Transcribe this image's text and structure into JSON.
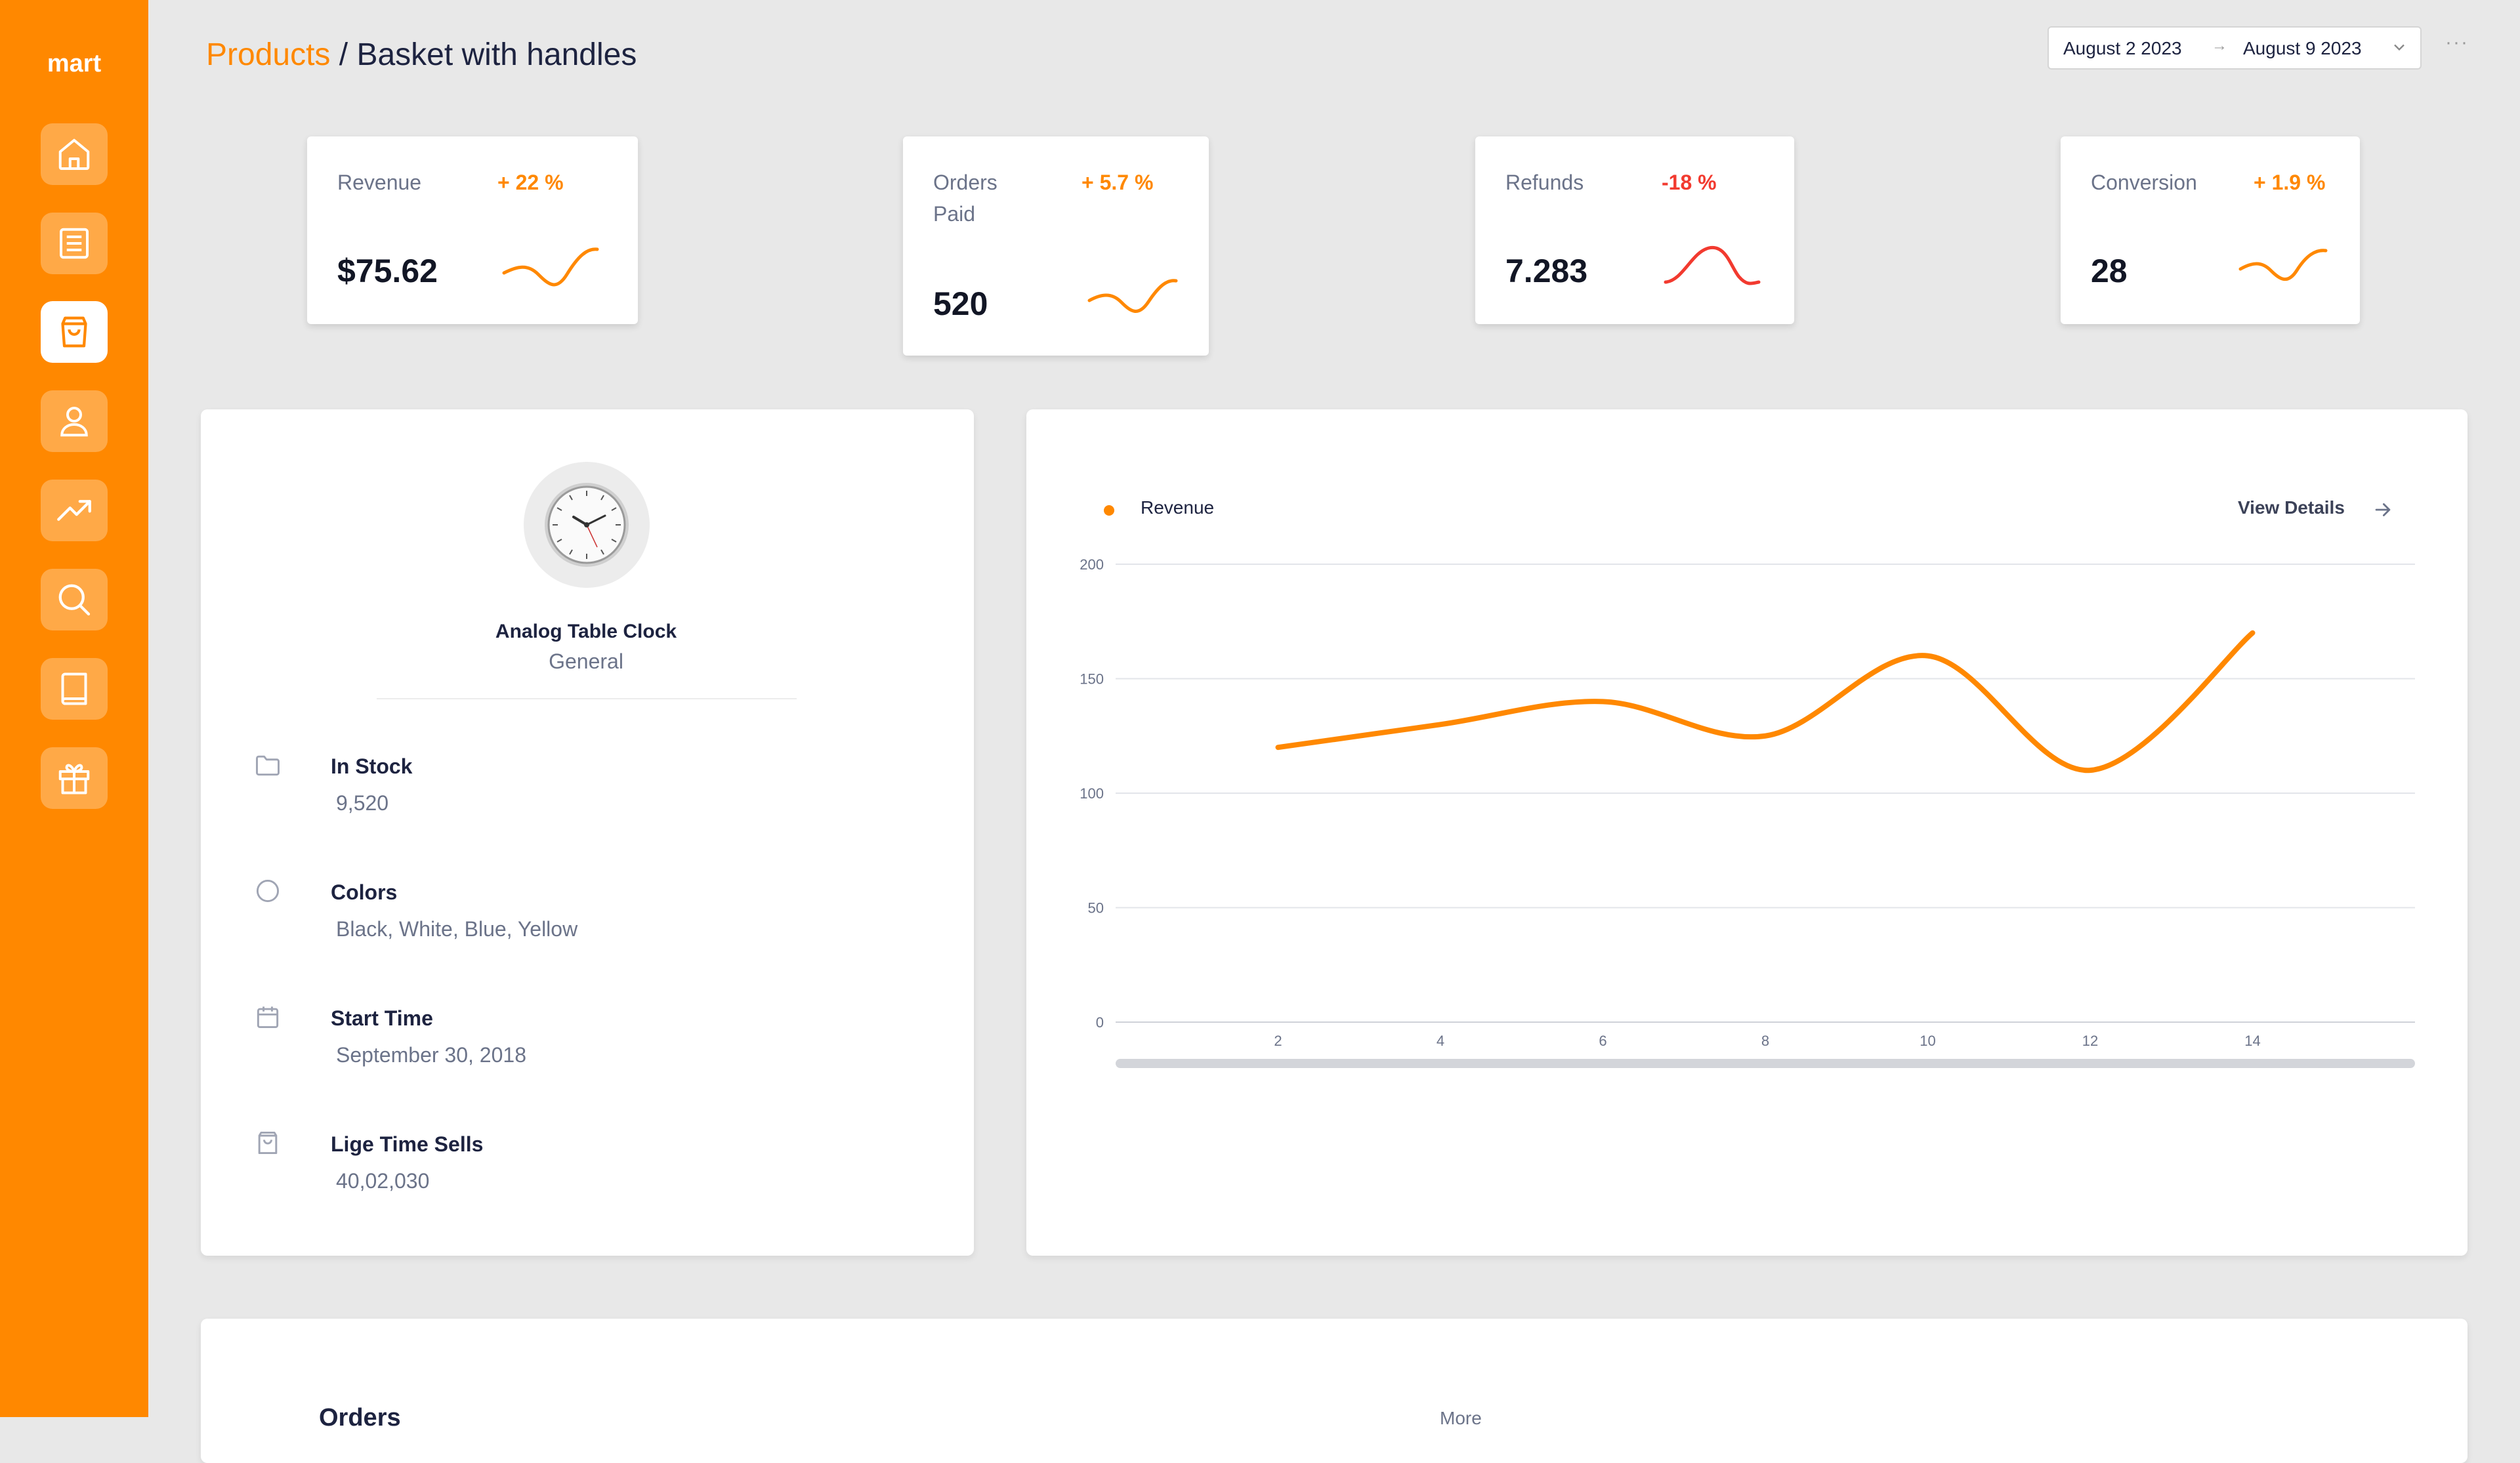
{
  "brand": "mart",
  "nav": [
    {
      "icon": "home-icon"
    },
    {
      "icon": "document-icon"
    },
    {
      "icon": "shopping-bag-icon",
      "active": true
    },
    {
      "icon": "user-icon"
    },
    {
      "icon": "trending-up-icon"
    },
    {
      "icon": "search-icon"
    },
    {
      "icon": "book-icon"
    },
    {
      "icon": "gift-icon"
    }
  ],
  "breadcrumb": {
    "section": "Products",
    "page": "/ Basket with handles"
  },
  "date_range": {
    "start": "August 2 2023",
    "separator": "→",
    "end": "August 9 2023"
  },
  "more_menu": "···",
  "kpis": [
    {
      "label": "Revenue",
      "delta": "+ 22 %",
      "value": "$75.62",
      "trend": "up"
    },
    {
      "label": "Orders Paid",
      "delta": "+ 5.7 %",
      "value": "520",
      "trend": "up"
    },
    {
      "label": "Refunds",
      "delta": "-18 %",
      "value": "7.283",
      "trend": "down"
    },
    {
      "label": "Conversion",
      "delta": "+ 1.9 %",
      "value": "28",
      "trend": "up"
    }
  ],
  "colors": {
    "accent": "#ff8800",
    "negative": "#f23a2f",
    "background": "#e8e8e8"
  },
  "product": {
    "name": "Analog Table Clock",
    "category": "General",
    "image_icon": "analog-clock-icon",
    "details": [
      {
        "icon": "folder-icon",
        "label": "In Stock",
        "value": "9,520"
      },
      {
        "icon": "circle-icon",
        "label": "Colors",
        "value": "Black, White, Blue, Yellow"
      },
      {
        "icon": "calendar-icon",
        "label": "Start Time",
        "value": "September 30, 2018"
      },
      {
        "icon": "bag-icon",
        "label": "Lige Time Sells",
        "value": "40,02,030"
      }
    ]
  },
  "chart": {
    "view_details_label": "View Details"
  },
  "chart_data": {
    "type": "line",
    "series": [
      {
        "name": "Revenue",
        "x": [
          2,
          4,
          6,
          8,
          10,
          12,
          14
        ],
        "values": [
          120,
          130,
          140,
          125,
          160,
          110,
          170
        ]
      }
    ],
    "xticks": [
      2,
      4,
      6,
      8,
      10,
      12,
      14
    ],
    "yticks": [
      0,
      50,
      100,
      150,
      200
    ],
    "xlim": [
      0,
      16
    ],
    "ylim": [
      0,
      200
    ],
    "grid": true,
    "legend": "top-left",
    "color": "#ff8800"
  },
  "orders": {
    "title": "Orders",
    "more_label": "More"
  }
}
